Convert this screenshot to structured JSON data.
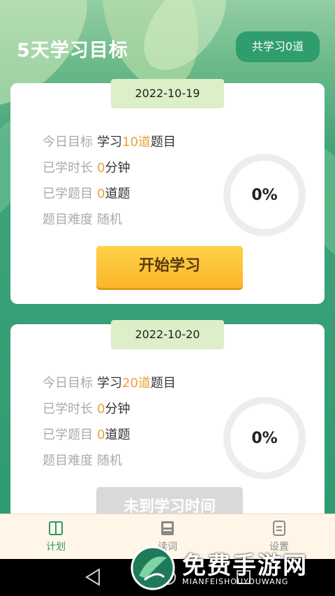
{
  "header": {
    "title": "5天学习目标",
    "total_badge": "共学习0道"
  },
  "cards": [
    {
      "date": "2022-10-19",
      "goal_label": "今日目标",
      "goal_prefix": "学习",
      "goal_num": "10",
      "goal_unit": "道",
      "goal_suffix": "题目",
      "time_label": "已学时长",
      "time_num": "0",
      "time_unit": "分钟",
      "count_label": "已学题目",
      "count_num": "0",
      "count_unit": "道题",
      "diff_label": "题目难度",
      "diff_value": "随机",
      "progress_text": "0%",
      "progress": 0,
      "button": "开始学习"
    },
    {
      "date": "2022-10-20",
      "goal_label": "今日目标",
      "goal_prefix": "学习",
      "goal_num": "20",
      "goal_unit": "道",
      "goal_suffix": "题目",
      "time_label": "已学时长",
      "time_num": "0",
      "time_unit": "分钟",
      "count_label": "已学题目",
      "count_num": "0",
      "count_unit": "道题",
      "diff_label": "题目难度",
      "diff_value": "随机",
      "progress_text": "0%",
      "progress": 0,
      "button": "未到学习时间"
    }
  ],
  "tabs": [
    {
      "label": "计划",
      "icon": "book-icon",
      "active": true
    },
    {
      "label": "读词",
      "icon": "answer-icon",
      "active": false
    },
    {
      "label": "设置",
      "icon": "settings-doc-icon",
      "active": false
    }
  ],
  "watermark": {
    "title": "免费手游网",
    "subtitle": "MIANFEISHOUYOUWANG"
  },
  "colors": {
    "accent_green": "#2e9a6a",
    "highlight_orange": "#e8a33a",
    "button_yellow": "#fbb52a"
  }
}
